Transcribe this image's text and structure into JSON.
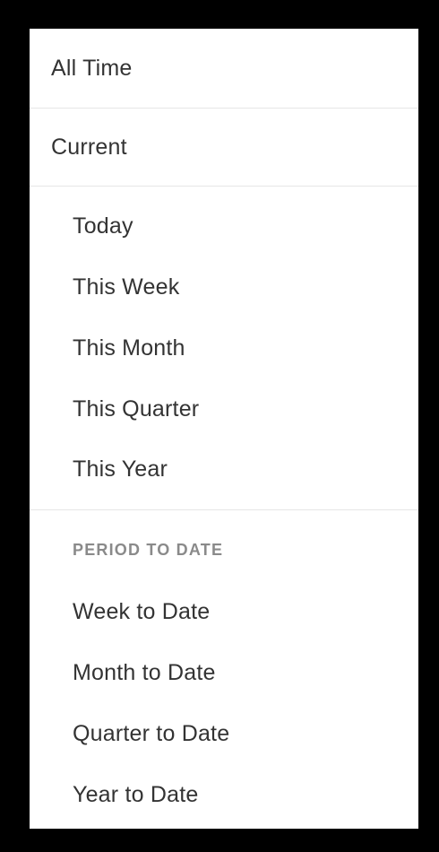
{
  "menu": {
    "all_time": "All Time",
    "current": "Current",
    "current_items": [
      {
        "label": "Today"
      },
      {
        "label": "This Week"
      },
      {
        "label": "This Month"
      },
      {
        "label": "This Quarter"
      },
      {
        "label": "This Year"
      }
    ],
    "period_heading": "PERIOD TO DATE",
    "period_items": [
      {
        "label": "Week to Date"
      },
      {
        "label": "Month to Date"
      },
      {
        "label": "Quarter to Date"
      },
      {
        "label": "Year to Date"
      }
    ]
  }
}
